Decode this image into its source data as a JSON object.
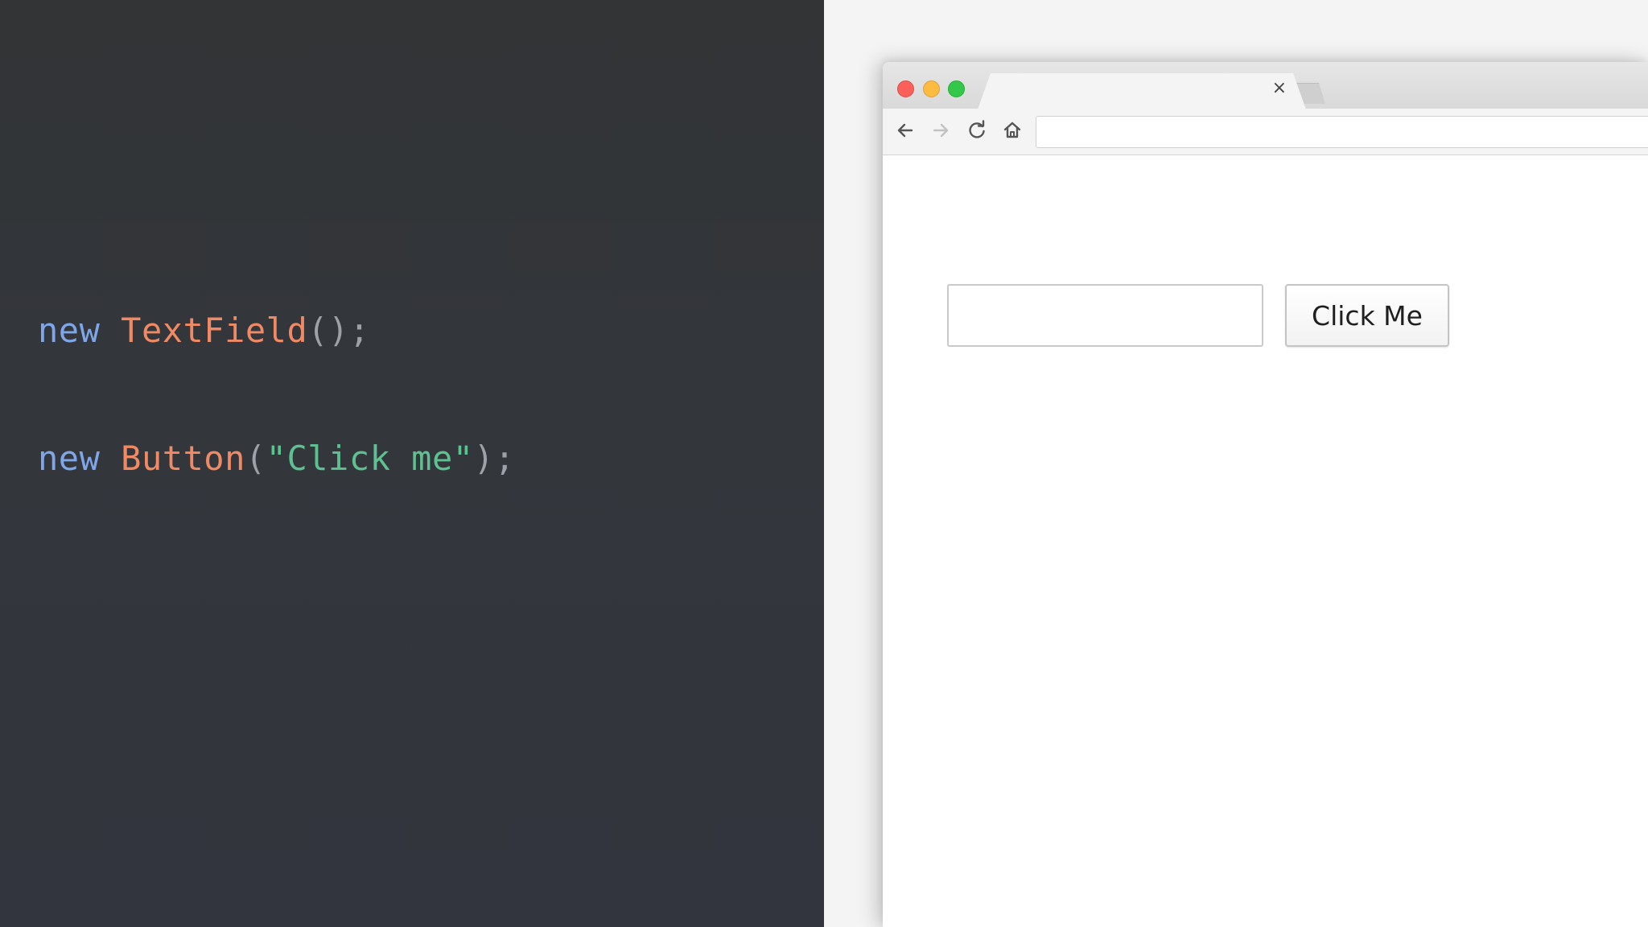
{
  "editor": {
    "lines": [
      {
        "keyword": "new",
        "type": "TextField",
        "open_paren": "(",
        "string": "",
        "close": ");"
      },
      {
        "keyword": "new",
        "type": "Button",
        "open_paren": "(",
        "string": "\"Click me\"",
        "close": ");"
      }
    ],
    "colors": {
      "keyword": "#7ea6e8",
      "type": "#ef8a65",
      "punctuation": "#9da1a8",
      "string": "#5fc192",
      "background": "#33363b"
    }
  },
  "browser": {
    "tab": {
      "title": "",
      "close_glyph": "×"
    },
    "toolbar": {
      "back_icon": "arrow-left-icon",
      "forward_icon": "arrow-right-icon",
      "reload_icon": "reload-icon",
      "home_icon": "home-icon",
      "address": ""
    },
    "traffic_lights": {
      "close": "#fc605b",
      "minimize": "#fdbc40",
      "maximize": "#34c84a"
    },
    "page": {
      "text_field_value": "",
      "button_label": "Click Me"
    }
  }
}
